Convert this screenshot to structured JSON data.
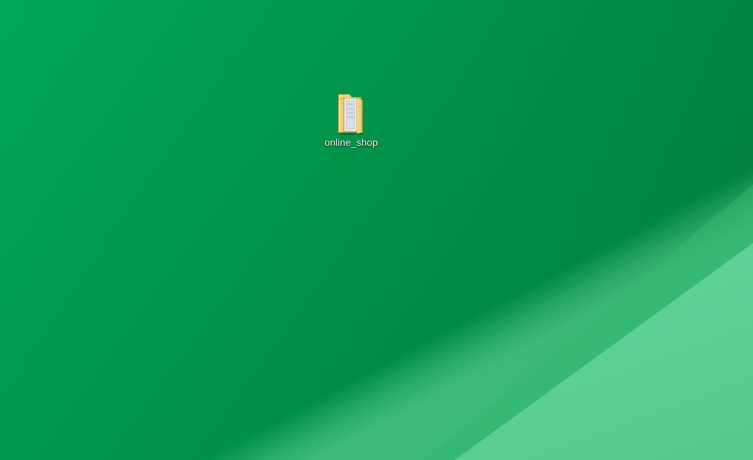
{
  "desktop": {
    "background_color": "#009a4d",
    "glare_color": "#69dba2",
    "icons": [
      {
        "label": "online_shop",
        "icon": "folder-icon",
        "folder_color": "#f4d06c"
      }
    ]
  }
}
